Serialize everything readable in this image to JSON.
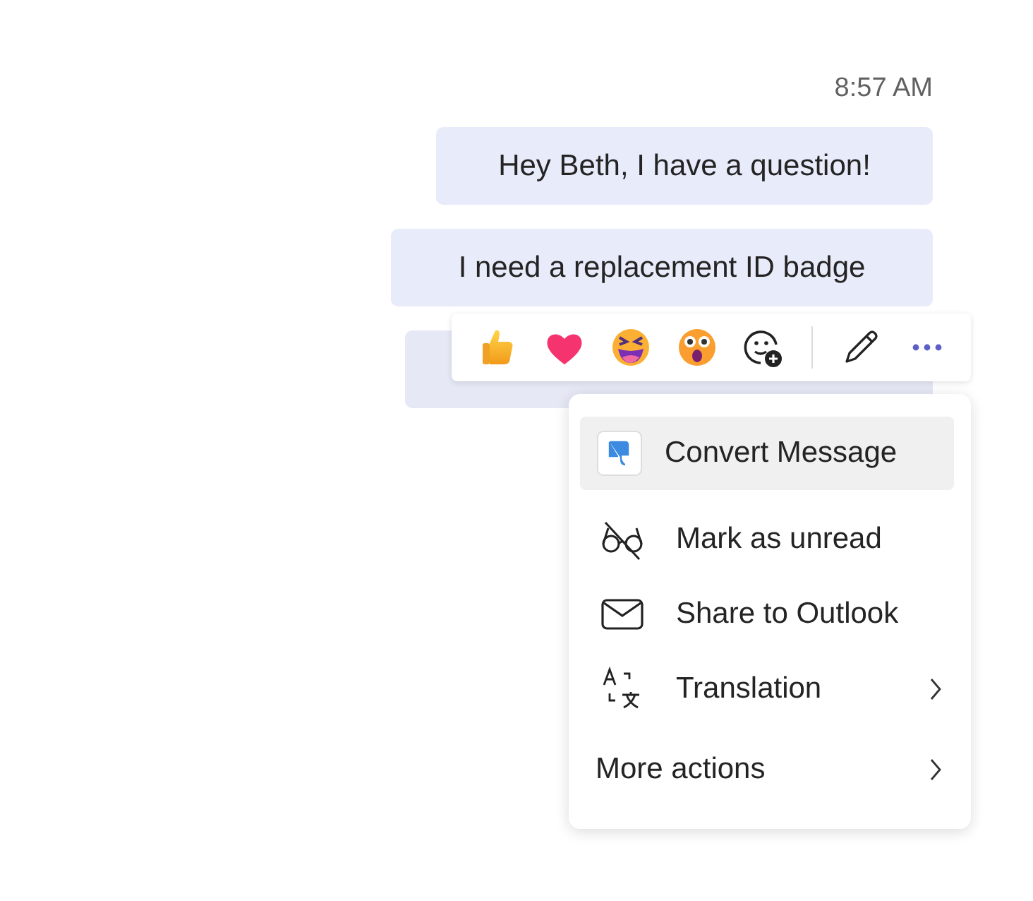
{
  "timestamp": "8:57 AM",
  "messages": [
    {
      "text": "Hey Beth, I have a question!"
    },
    {
      "text": "I need a replacement ID badge"
    },
    {
      "covered": true
    }
  ],
  "reactions": [
    {
      "kind": "like"
    },
    {
      "kind": "heart"
    },
    {
      "kind": "laugh"
    },
    {
      "kind": "surprised"
    },
    {
      "kind": "add"
    }
  ],
  "toolbar_actions": [
    {
      "kind": "edit"
    },
    {
      "kind": "more"
    }
  ],
  "menu": [
    {
      "kind": "app",
      "label": "Convert Message",
      "selected": true,
      "submenu": false
    },
    {
      "kind": "unread",
      "label": "Mark as unread",
      "selected": false,
      "submenu": false
    },
    {
      "kind": "mail",
      "label": "Share to Outlook",
      "selected": false,
      "submenu": false
    },
    {
      "kind": "translate",
      "label": "Translation",
      "selected": false,
      "submenu": true
    },
    {
      "kind": "none",
      "label": "More actions",
      "selected": false,
      "submenu": true
    }
  ]
}
